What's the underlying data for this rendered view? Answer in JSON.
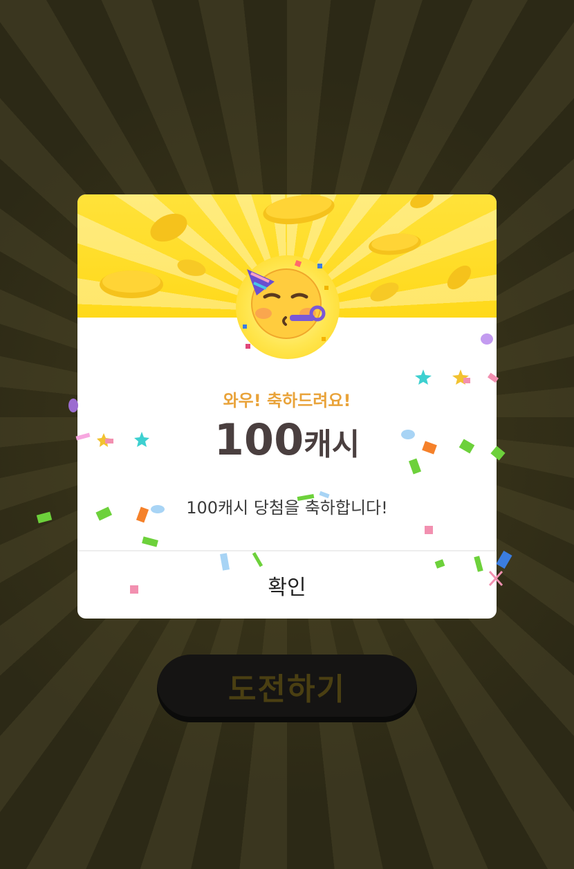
{
  "background_button": {
    "label": "도전하기"
  },
  "modal": {
    "subtitle": "와우! 축하드려요!",
    "amount_number": "100",
    "amount_unit": "캐시",
    "message": "100캐시 당첨을 축하합니다!",
    "confirm_label": "확인"
  },
  "icons": {
    "hero": "party-face-icon"
  },
  "colors": {
    "banner": "#ffde2b",
    "subtitle": "#e9a33a",
    "amount": "#4a3f3f",
    "background": "#2f2c1a"
  }
}
